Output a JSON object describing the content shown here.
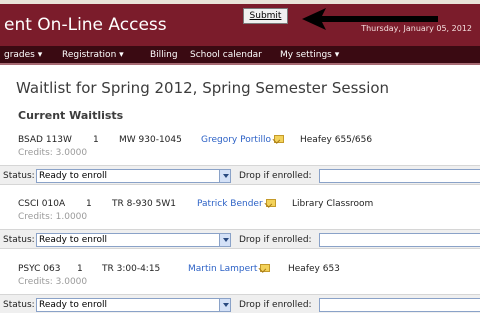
{
  "header": {
    "title": "ent On-Line Access",
    "date": "Thursday, January 05, 2012",
    "submit_label": "Submit"
  },
  "nav": {
    "items": [
      {
        "label": "grades ▾"
      },
      {
        "label": "Registration ▾"
      },
      {
        "label": "Billing"
      },
      {
        "label": "School calendar"
      },
      {
        "label": "My settings ▾"
      }
    ]
  },
  "page": {
    "title": "Waitlist for Spring 2012, Spring Semester Session",
    "section_title": "Current Waitlists"
  },
  "labels": {
    "status": "Status:",
    "drop_if_enrolled": "Drop if enrolled:"
  },
  "waitlists": [
    {
      "course": "BSAD 113W",
      "section": "1",
      "schedule": "MW 930-1045",
      "instructor": "Gregory Portillo",
      "location": "Heafey 655/656",
      "credits": "Credits: 3.0000",
      "status_value": "Ready to enroll",
      "drop_value": ""
    },
    {
      "course": "CSCI 010A",
      "section": "1",
      "schedule": "TR 8-930 5W1",
      "instructor": "Patrick Bender",
      "location": "Library Classroom",
      "credits": "Credits: 1.0000",
      "status_value": "Ready to enroll",
      "drop_value": ""
    },
    {
      "course": "PSYC 063",
      "section": "1",
      "schedule": "TR 3:00-4:15",
      "instructor": "Martin Lampert",
      "location": "Heafey 653",
      "credits": "Credits: 3.0000",
      "status_value": "Ready to enroll",
      "drop_value": ""
    }
  ],
  "colors": {
    "banner": "#7b1c2b",
    "nav": "#3a0a12",
    "link": "#2d62c6"
  },
  "icons": {
    "mail": "envelope-icon",
    "arrow": "left-arrow-icon",
    "dropdown": "chevron-down-icon"
  }
}
